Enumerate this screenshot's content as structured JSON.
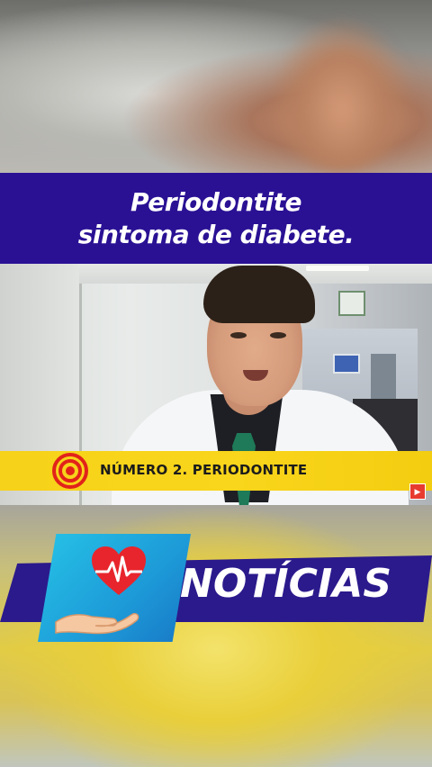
{
  "title": {
    "line1": "Periodontite",
    "line2": "sintoma de diabete."
  },
  "video": {
    "lower_third_text": "NÚMERO 2. PERIODONTITE",
    "channel_badge": "▶"
  },
  "news": {
    "label": "NOTÍCIAS"
  },
  "icons": {
    "target": "target-icon",
    "heart": "heart-pulse-icon",
    "hand": "hand-icon"
  },
  "colors": {
    "title_band": "#2a1194",
    "lower_third": "#f6d21a",
    "news_band": "#2b1a8c",
    "logo_card": "#26c3e6",
    "heart": "#e8252c"
  }
}
